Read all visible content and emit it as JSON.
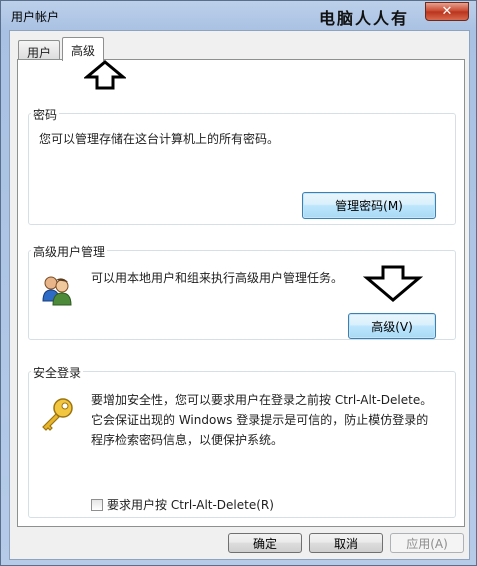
{
  "window": {
    "title": "用户帐户",
    "overlay_text": "电脑人人有",
    "close_symbol": "✕"
  },
  "tabs": [
    {
      "label": "用户"
    },
    {
      "label": "高级"
    }
  ],
  "passwords": {
    "label": "密码",
    "description": "您可以管理存储在这台计算机上的所有密码。",
    "button": "管理密码(M)"
  },
  "advanced_users": {
    "label": "高级用户管理",
    "description": "可以用本地用户和组来执行高级用户管理任务。",
    "button": "高级(V)"
  },
  "secure_logon": {
    "label": "安全登录",
    "description_1": "要增加安全性，您可以要求用户在登录之前按 Ctrl-Alt-Delete。",
    "description_2": "它会保证出现的 Windows 登录提示是可信的，防止模仿登录的",
    "description_3": "程序检索密码信息，以便保护系统。",
    "checkbox_label": "要求用户按 Ctrl-Alt-Delete(R)",
    "checked": false
  },
  "footer": {
    "ok": "确定",
    "cancel": "取消",
    "apply": "应用(A)"
  },
  "colors": {
    "focus_border": "#3c7fb1",
    "close_red": "#c7442b"
  },
  "icons": [
    "close-icon",
    "users-icon",
    "key-icon",
    "arrow-up-icon",
    "arrow-down-icon"
  ]
}
